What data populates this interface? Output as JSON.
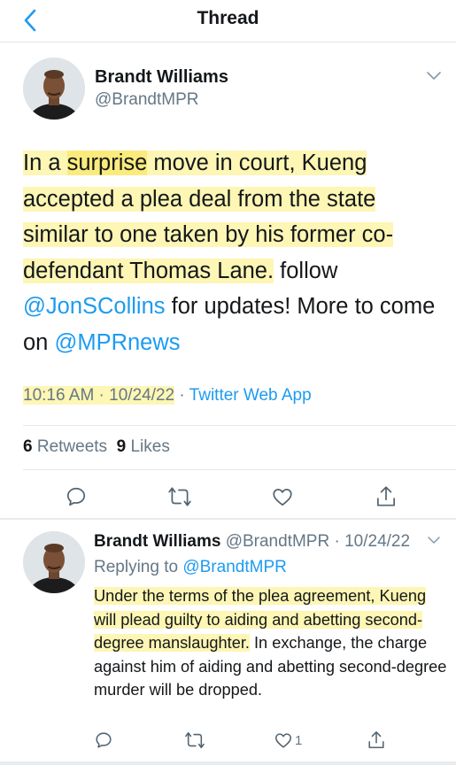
{
  "header": {
    "title": "Thread",
    "back_icon": "chevron-left-icon"
  },
  "main_tweet": {
    "author_name": "Brandt Williams",
    "author_handle": "@BrandtMPR",
    "text": {
      "p1": "In a ",
      "p2": "surprise",
      "p3": " move in court, Kueng accepted a plea deal from the state similar to one taken by his former co-defendant Thomas Lane.",
      "p4": " follow ",
      "mention1": "@JonSCollins",
      "p5": " for updates! More to come on ",
      "mention2": "@MPRnews"
    },
    "timestamp": "10:16 AM · 10/24/22",
    "dot": " · ",
    "source": "Twitter Web App",
    "retweets_count": "6",
    "retweets_label": "Retweets",
    "likes_count": "9",
    "likes_label": "Likes"
  },
  "reply_tweet": {
    "author_name": "Brandt Williams",
    "author_handle": "@BrandtMPR",
    "date": " · 10/24/22",
    "replying_label": "Replying to ",
    "replying_to": "@BrandtMPR",
    "text_highlighted": "Under the terms of the plea agreement, Kueng will plead guilty to aiding and abetting second-degree manslaughter.",
    "text_rest": " In exchange, the charge against him of aiding and abetting second-degree murder will be dropped.",
    "like_count": "1"
  },
  "colors": {
    "link": "#1d9bf0",
    "highlight": "#fdf6b4",
    "secondary": "#657786",
    "icon": "#536471"
  }
}
